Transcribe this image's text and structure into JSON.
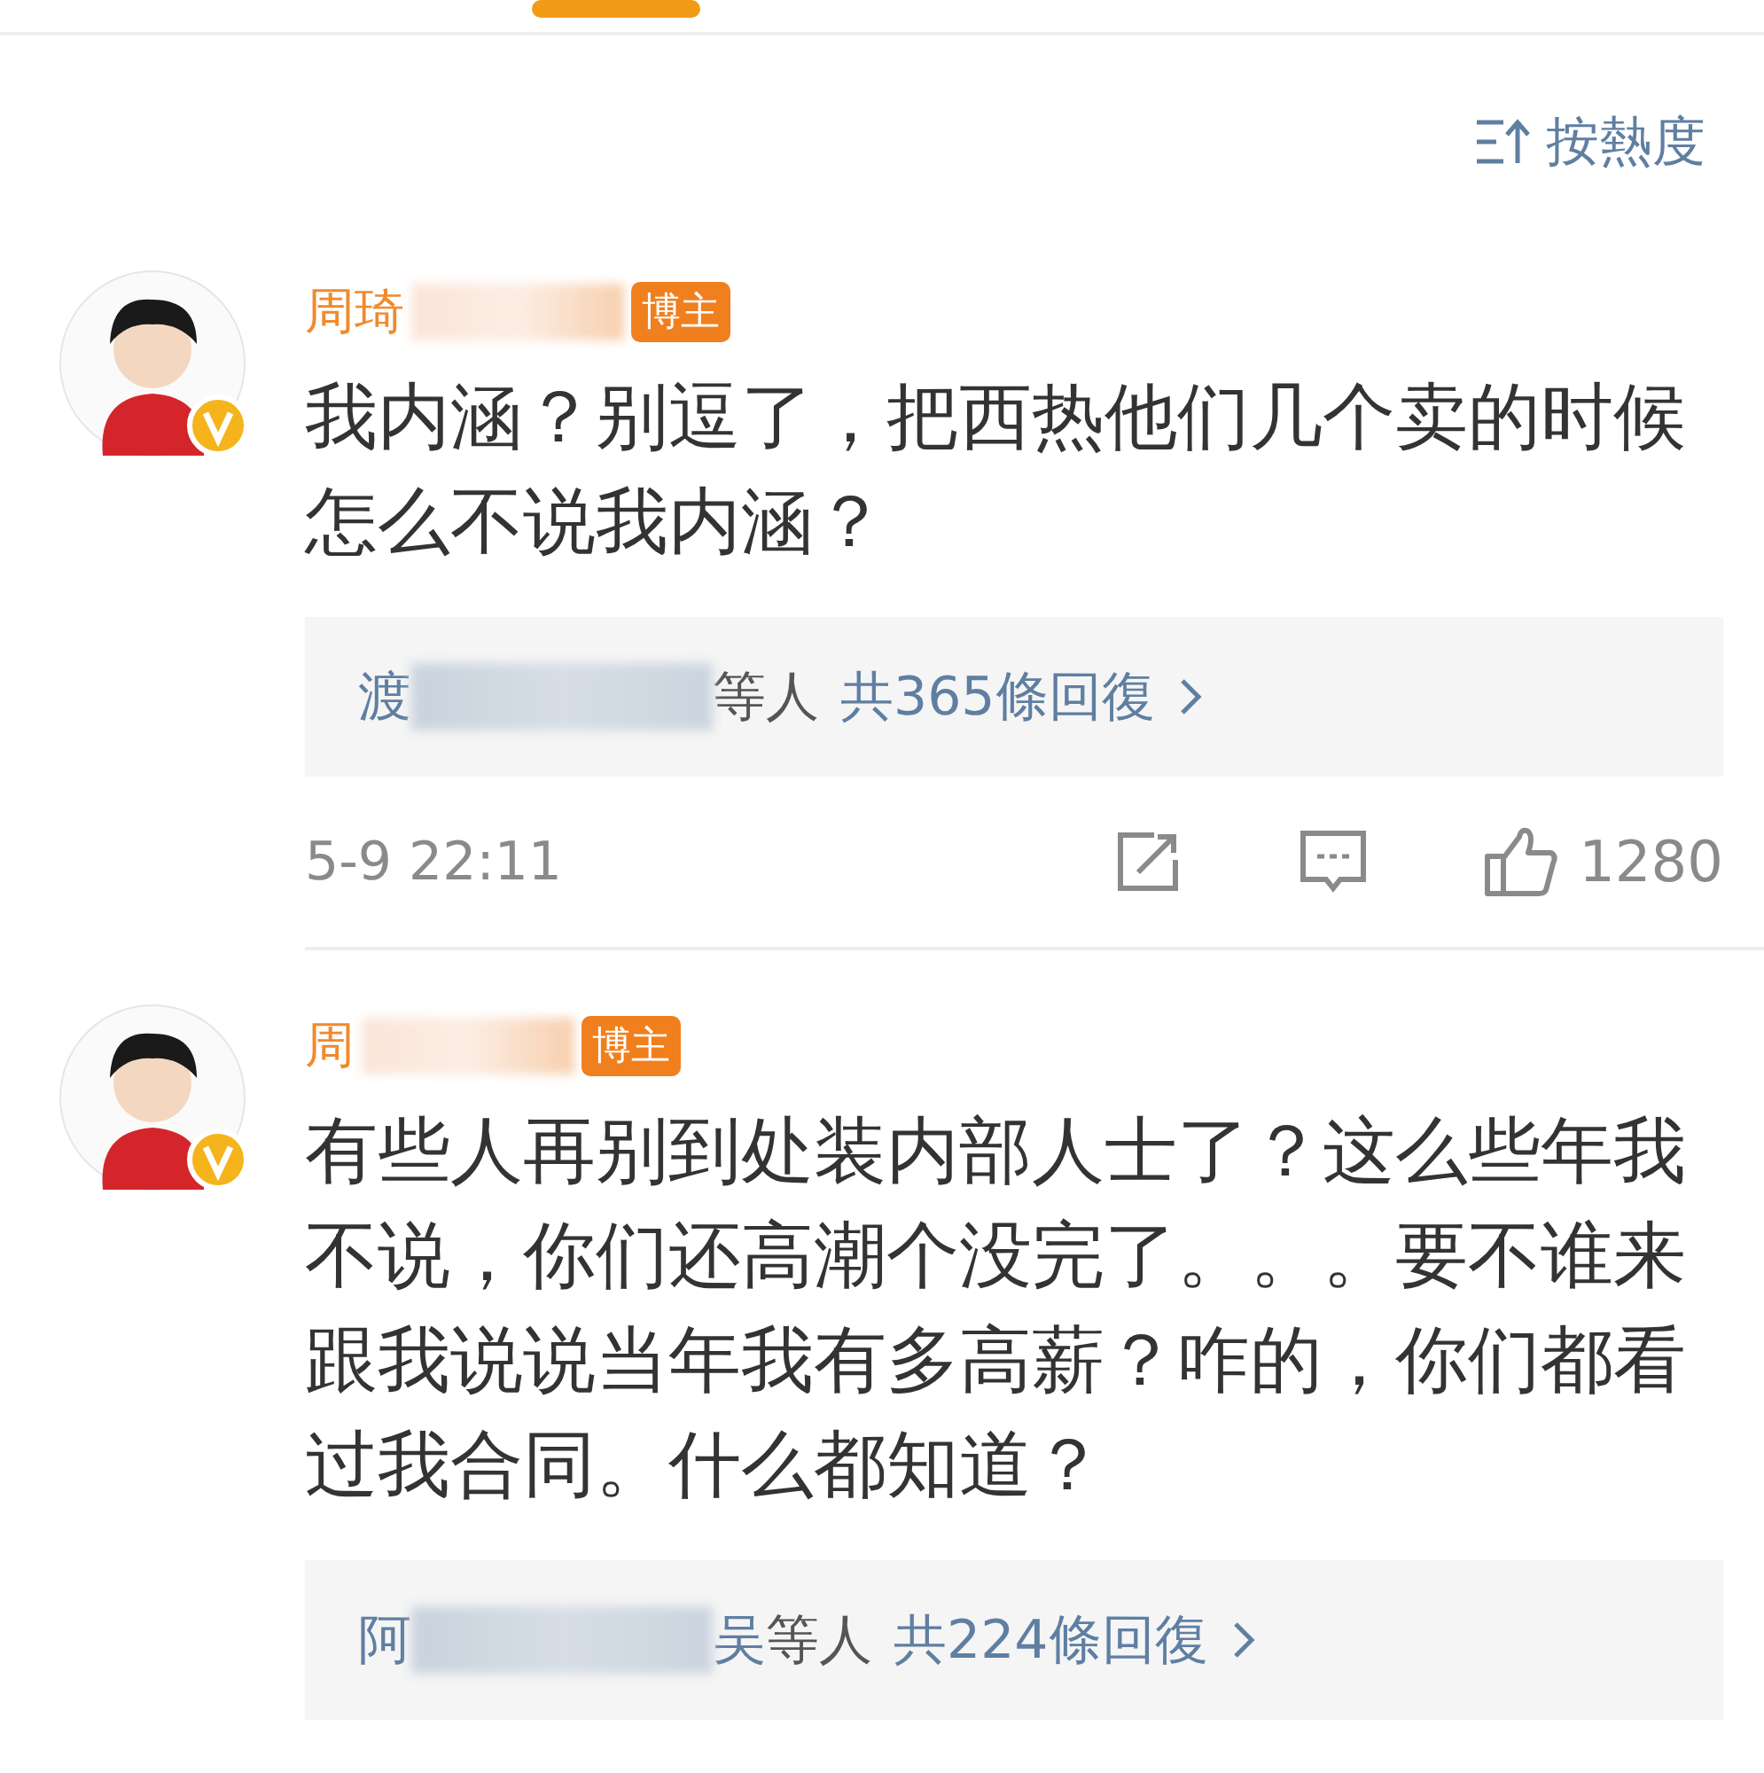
{
  "tabs_indicator": {
    "selected": true
  },
  "sort": {
    "label": "按熱度"
  },
  "comments": [
    {
      "name": "周琦",
      "badge": "博主",
      "verified": true,
      "text": "我内涵？别逗了，把西热他们几个卖的时候怎么不说我内涵？",
      "replies": {
        "first": "渡",
        "suffix": "等人",
        "total": "共365條回復"
      },
      "time": "5-9 22:11",
      "likes": "1280"
    },
    {
      "name": "周",
      "badge": "博主",
      "verified": true,
      "text": "有些人再别到处装内部人士了？这么些年我不说，你们还高潮个没完了。。。要不谁来跟我说说当年我有多高薪？咋的，你们都看过我合同。什么都知道？",
      "replies": {
        "first": "阿",
        "last": "吴",
        "suffix": "等人",
        "total": "共224條回復"
      }
    }
  ]
}
